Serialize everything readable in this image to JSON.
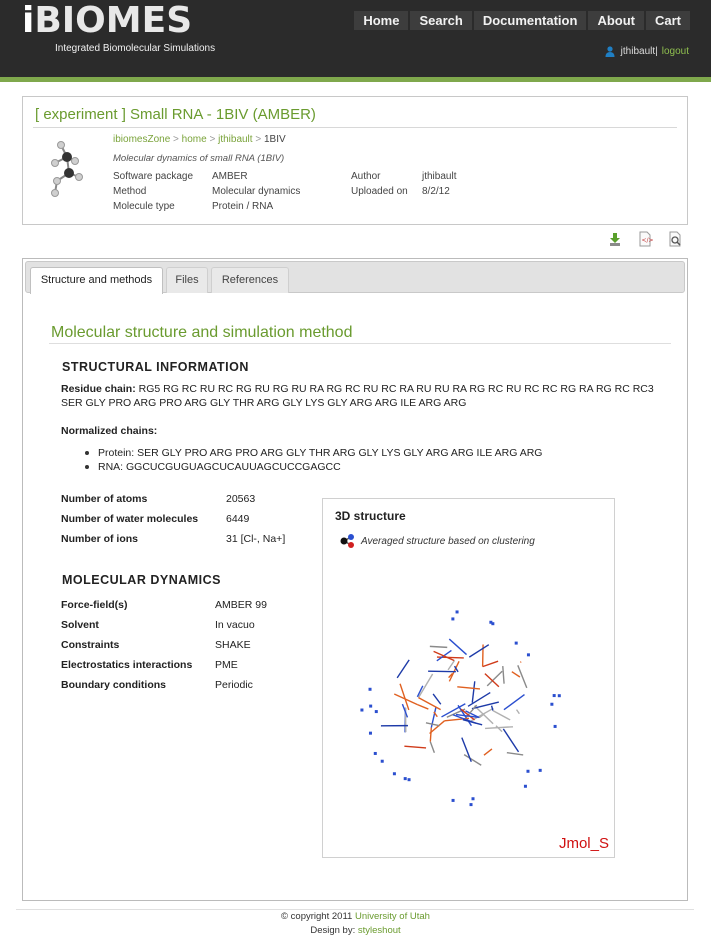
{
  "header": {
    "logo_i": "i",
    "logo_rest": "BIOMES",
    "tagline": "Integrated Biomolecular Simulations",
    "nav": [
      "Home",
      "Search",
      "Documentation",
      "About",
      "Cart"
    ],
    "user": "jthibault",
    "separator": "|",
    "logout": "logout"
  },
  "experiment": {
    "title": "[ experiment ] Small RNA - 1BIV (AMBER)",
    "breadcrumb": [
      "ibiomesZone",
      "home",
      "jthibault",
      "1BIV"
    ],
    "breadcrumb_sep": ">",
    "description": "Molecular dynamics of small RNA (1BIV)",
    "software_label": "Software package",
    "software_value": "AMBER",
    "method_label": "Method",
    "method_value": "Molecular dynamics",
    "moltype_label": "Molecule type",
    "moltype_value": "Protein / RNA",
    "author_label": "Author",
    "author_value": "jthibault",
    "uploaded_label": "Uploaded on",
    "uploaded_value": "8/2/12"
  },
  "tool_icons": [
    "download-icon",
    "xml-file-icon",
    "preview-icon"
  ],
  "tabs": [
    "Structure and methods",
    "Files",
    "References"
  ],
  "section_title": "Molecular structure and simulation method",
  "structural": {
    "heading": "STRUCTURAL INFORMATION",
    "residue_label": "Residue chain:",
    "residue_line1": "RG5 RG RC RU RC RG RU RG RU RA RG RC RU RC RA RU RU RA RG RC RU RC RC RG RA RG RC RC3",
    "residue_line2": "SER GLY PRO ARG PRO ARG GLY THR ARG GLY LYS GLY ARG ARG ILE ARG ARG",
    "normalized_label": "Normalized chains:",
    "chain_protein": "Protein: SER GLY PRO ARG PRO ARG GLY THR ARG GLY LYS GLY ARG ARG ILE ARG ARG",
    "chain_rna": "RNA: GGCUCGUGUAGCUCAUUAGCUCCGAGCC",
    "atoms_label": "Number of atoms",
    "atoms_value": "20563",
    "water_label": "Number of water molecules",
    "water_value": "6449",
    "ions_label": "Number of ions",
    "ions_value": "31 [Cl-, Na+]"
  },
  "md": {
    "heading": "MOLECULAR DYNAMICS",
    "rows": [
      {
        "label": "Force-field(s)",
        "value": "AMBER 99"
      },
      {
        "label": "Solvent",
        "value": "In vacuo"
      },
      {
        "label": "Constraints",
        "value": "SHAKE"
      },
      {
        "label": "Electrostatics interactions",
        "value": "PME"
      },
      {
        "label": "Boundary conditions",
        "value": "Periodic"
      }
    ]
  },
  "structure3d": {
    "title": "3D structure",
    "caption": "Averaged structure based on clustering",
    "viewer_label": "Jmol_S"
  },
  "footer": {
    "copyright": "© copyright 2011",
    "university": "University of Utah",
    "design_by": "Design by:",
    "designer": "styleshout"
  },
  "colors": {
    "accent_green": "#6a9b2f",
    "header_bg": "#2b2b2b",
    "jmol_red": "#d01010"
  }
}
